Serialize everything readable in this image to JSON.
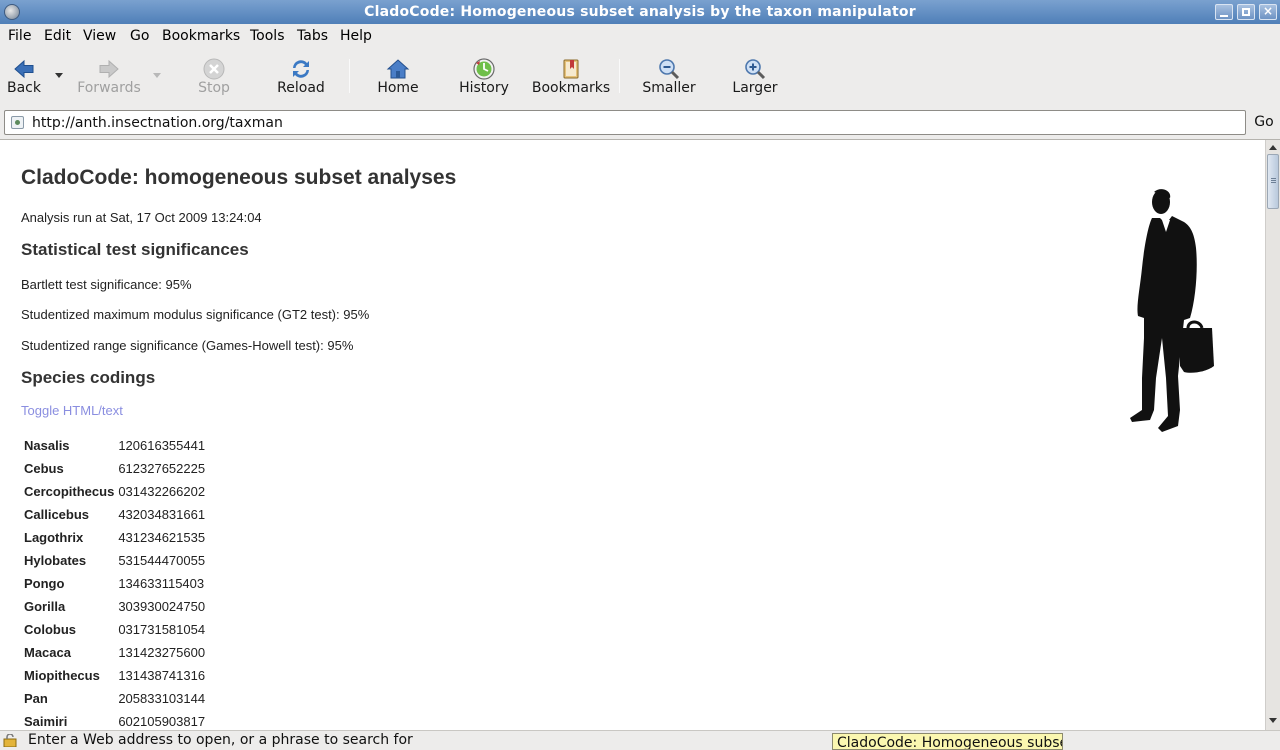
{
  "window": {
    "title": "CladoCode: Homogeneous subset analysis by the taxon manipulator"
  },
  "menu": {
    "items": [
      "File",
      "Edit",
      "View",
      "Go",
      "Bookmarks",
      "Tools",
      "Tabs",
      "Help"
    ]
  },
  "toolbar": {
    "back": "Back",
    "forwards": "Forwards",
    "stop": "Stop",
    "reload": "Reload",
    "home": "Home",
    "history": "History",
    "bookmarks": "Bookmarks",
    "smaller": "Smaller",
    "larger": "Larger"
  },
  "location": {
    "url": "http://anth.insectnation.org/taxman",
    "go_label": "Go"
  },
  "page": {
    "title": "CladoCode: homogeneous subset analyses",
    "run_info": "Analysis run at Sat, 17 Oct 2009 13:24:04",
    "stats_heading": "Statistical test significances",
    "bartlett": "Bartlett test significance: 95%",
    "gt2": "Studentized maximum modulus significance (GT2 test): 95%",
    "games_howell": "Studentized range significance (Games-Howell test): 95%",
    "species_heading": "Species codings",
    "toggle_link": "Toggle HTML/text",
    "species": [
      {
        "name": "Nasalis",
        "code": "120616355441"
      },
      {
        "name": "Cebus",
        "code": "612327652225"
      },
      {
        "name": "Cercopithecus",
        "code": "031432266202"
      },
      {
        "name": "Callicebus",
        "code": "432034831661"
      },
      {
        "name": "Lagothrix",
        "code": "431234621535"
      },
      {
        "name": "Hylobates",
        "code": "531544470055"
      },
      {
        "name": "Pongo",
        "code": "134633115403"
      },
      {
        "name": "Gorilla",
        "code": "303930024750"
      },
      {
        "name": "Colobus",
        "code": "031731581054"
      },
      {
        "name": "Macaca",
        "code": "131423275600"
      },
      {
        "name": "Miopithecus",
        "code": "131438741316"
      },
      {
        "name": "Pan",
        "code": "205833103144"
      },
      {
        "name": "Saimiri",
        "code": "602105903817"
      }
    ]
  },
  "status": {
    "text": "Enter a Web address to open, or a phrase to search for",
    "tooltip": "CladoCode: Homogeneous subset"
  },
  "colors": {
    "titlebar": "#5a86bd",
    "link": "#8a8ee0",
    "tooltip_bg": "#fbf7b0"
  }
}
